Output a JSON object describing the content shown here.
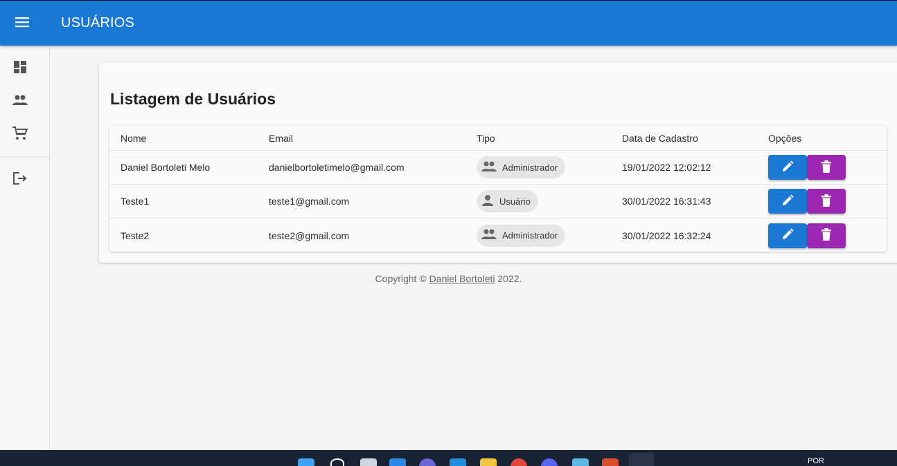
{
  "appbar": {
    "title": "USUÁRIOS",
    "menu_icon": "menu-icon"
  },
  "sidebar": {
    "items": [
      {
        "name": "dashboard",
        "icon": "dashboard-icon"
      },
      {
        "name": "users",
        "icon": "users-icon"
      },
      {
        "name": "cart",
        "icon": "cart-icon"
      },
      {
        "name": "logout",
        "icon": "logout-icon"
      }
    ]
  },
  "card": {
    "title": "Listagem de Usuários"
  },
  "table": {
    "headers": [
      "Nome",
      "Email",
      "Tipo",
      "Data de Cadastro",
      "Opções"
    ],
    "rows": [
      {
        "nome": "Daniel Bortoleti Melo",
        "email": "danielbortoletimelo@gmail.com",
        "tipo": "Administrador",
        "tipo_icon": "admin-group-icon",
        "data": "19/01/2022 12:02:12"
      },
      {
        "nome": "Teste1",
        "email": "teste1@gmail.com",
        "tipo": "Usuário",
        "tipo_icon": "person-icon",
        "data": "30/01/2022 16:31:43"
      },
      {
        "nome": "Teste2",
        "email": "teste2@gmail.com",
        "tipo": "Administrador",
        "tipo_icon": "admin-group-icon",
        "data": "30/01/2022 16:32:24"
      }
    ]
  },
  "footer": {
    "prefix": "Copyright © ",
    "link": "Daniel Bortoleti",
    "suffix": " 2022."
  },
  "taskbar": {
    "lang": "POR"
  },
  "colors": {
    "primary": "#1b78d4",
    "delete": "#9c27b0",
    "taskbar": "#1a2333"
  }
}
